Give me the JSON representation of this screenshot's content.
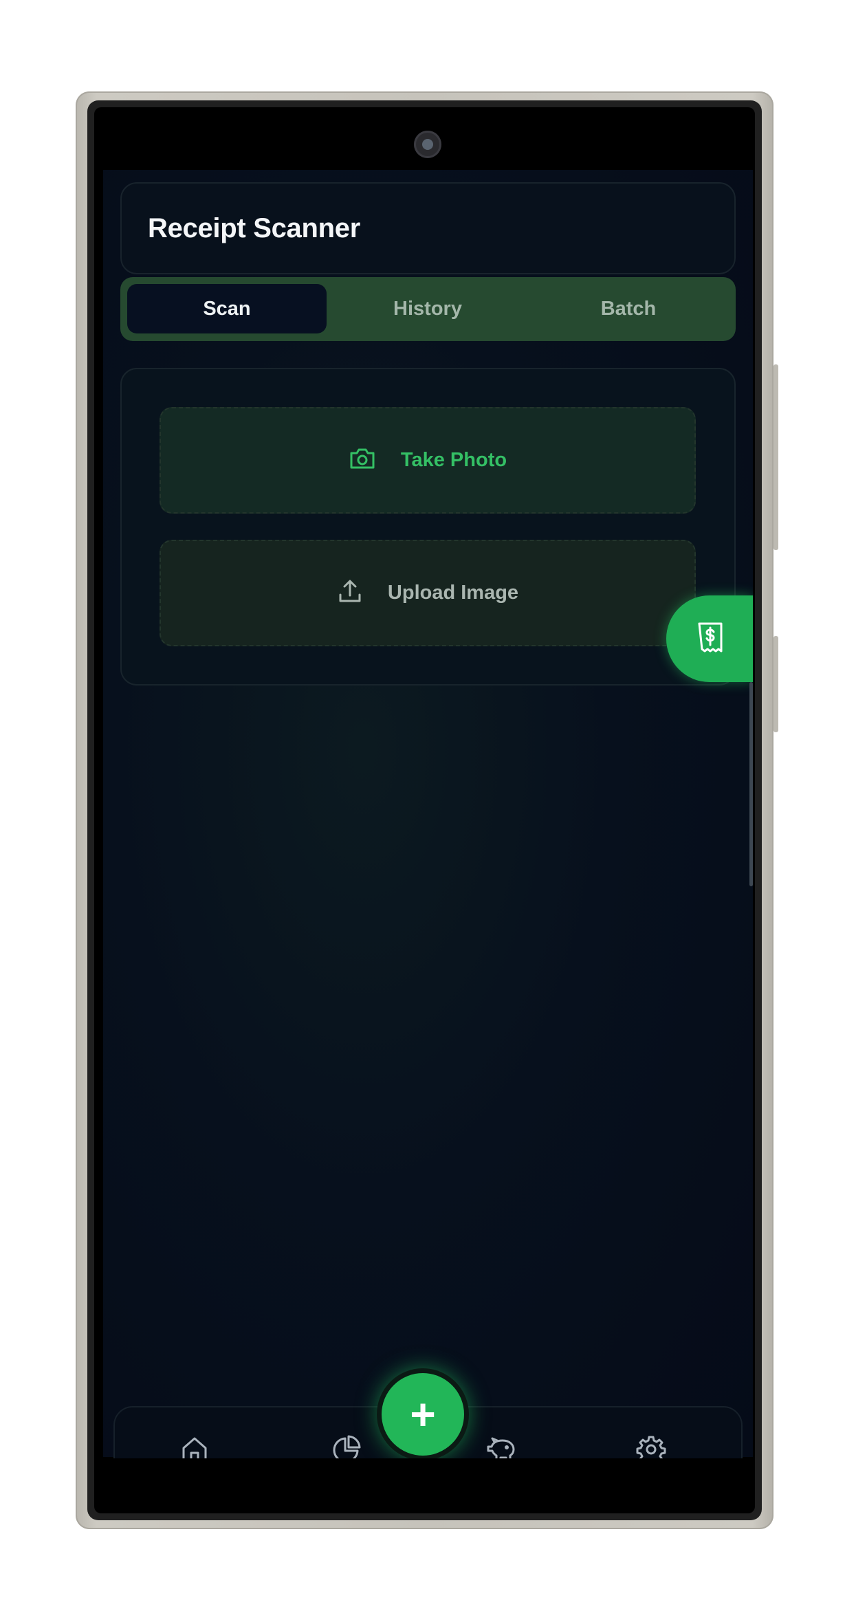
{
  "app": {
    "title": "Receipt Scanner"
  },
  "tabs": [
    {
      "label": "Scan",
      "active": true
    },
    {
      "label": "History",
      "active": false
    },
    {
      "label": "Batch",
      "active": false
    }
  ],
  "scan_panel": {
    "take_photo_label": "Take Photo",
    "take_photo_icon": "camera-icon",
    "upload_label": "Upload Image",
    "upload_icon": "upload-icon"
  },
  "floating_actions": {
    "side_fab_icon": "receipt-dollar-icon",
    "main_fab_label": "+"
  },
  "bottom_nav": [
    {
      "icon": "home-icon"
    },
    {
      "icon": "pie-chart-icon"
    },
    {
      "icon": "piggy-bank-icon"
    },
    {
      "icon": "gear-icon"
    }
  ],
  "colors": {
    "accent": "#22b658",
    "background": "#050b18",
    "tab_bar": "#264a30",
    "active_tab": "#071021"
  }
}
